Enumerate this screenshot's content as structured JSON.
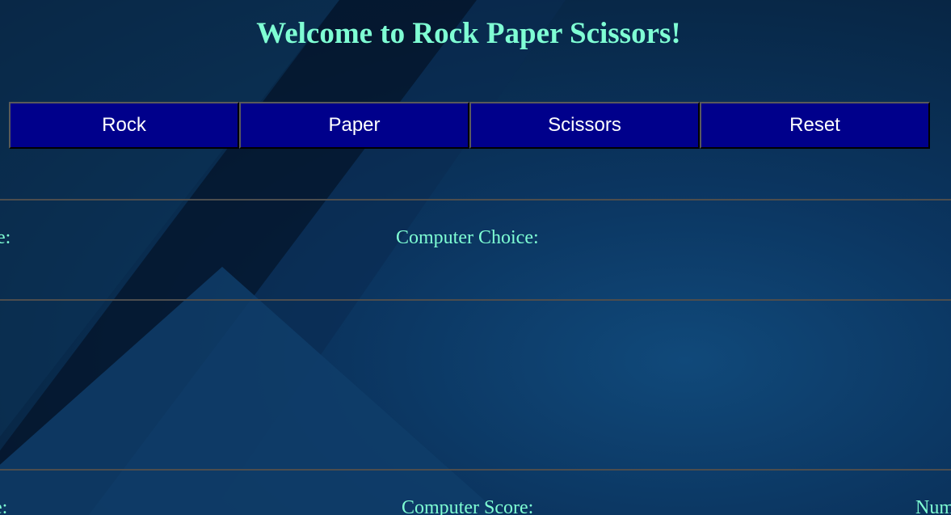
{
  "header": {
    "title": "Welcome to Rock Paper Scissors!"
  },
  "buttons": {
    "rock": "Rock",
    "paper": "Paper",
    "scissors": "Scissors",
    "reset": "Reset"
  },
  "choices": {
    "user_choice_partial": "e:",
    "computer_choice": "Computer Choice:"
  },
  "scores": {
    "user_score_partial": "e:",
    "computer_score": "Computer Score:",
    "number_partial": "Num"
  },
  "colors": {
    "accent_text": "#7fffd4",
    "button_bg": "#00008b",
    "background": "#0b2f55"
  }
}
